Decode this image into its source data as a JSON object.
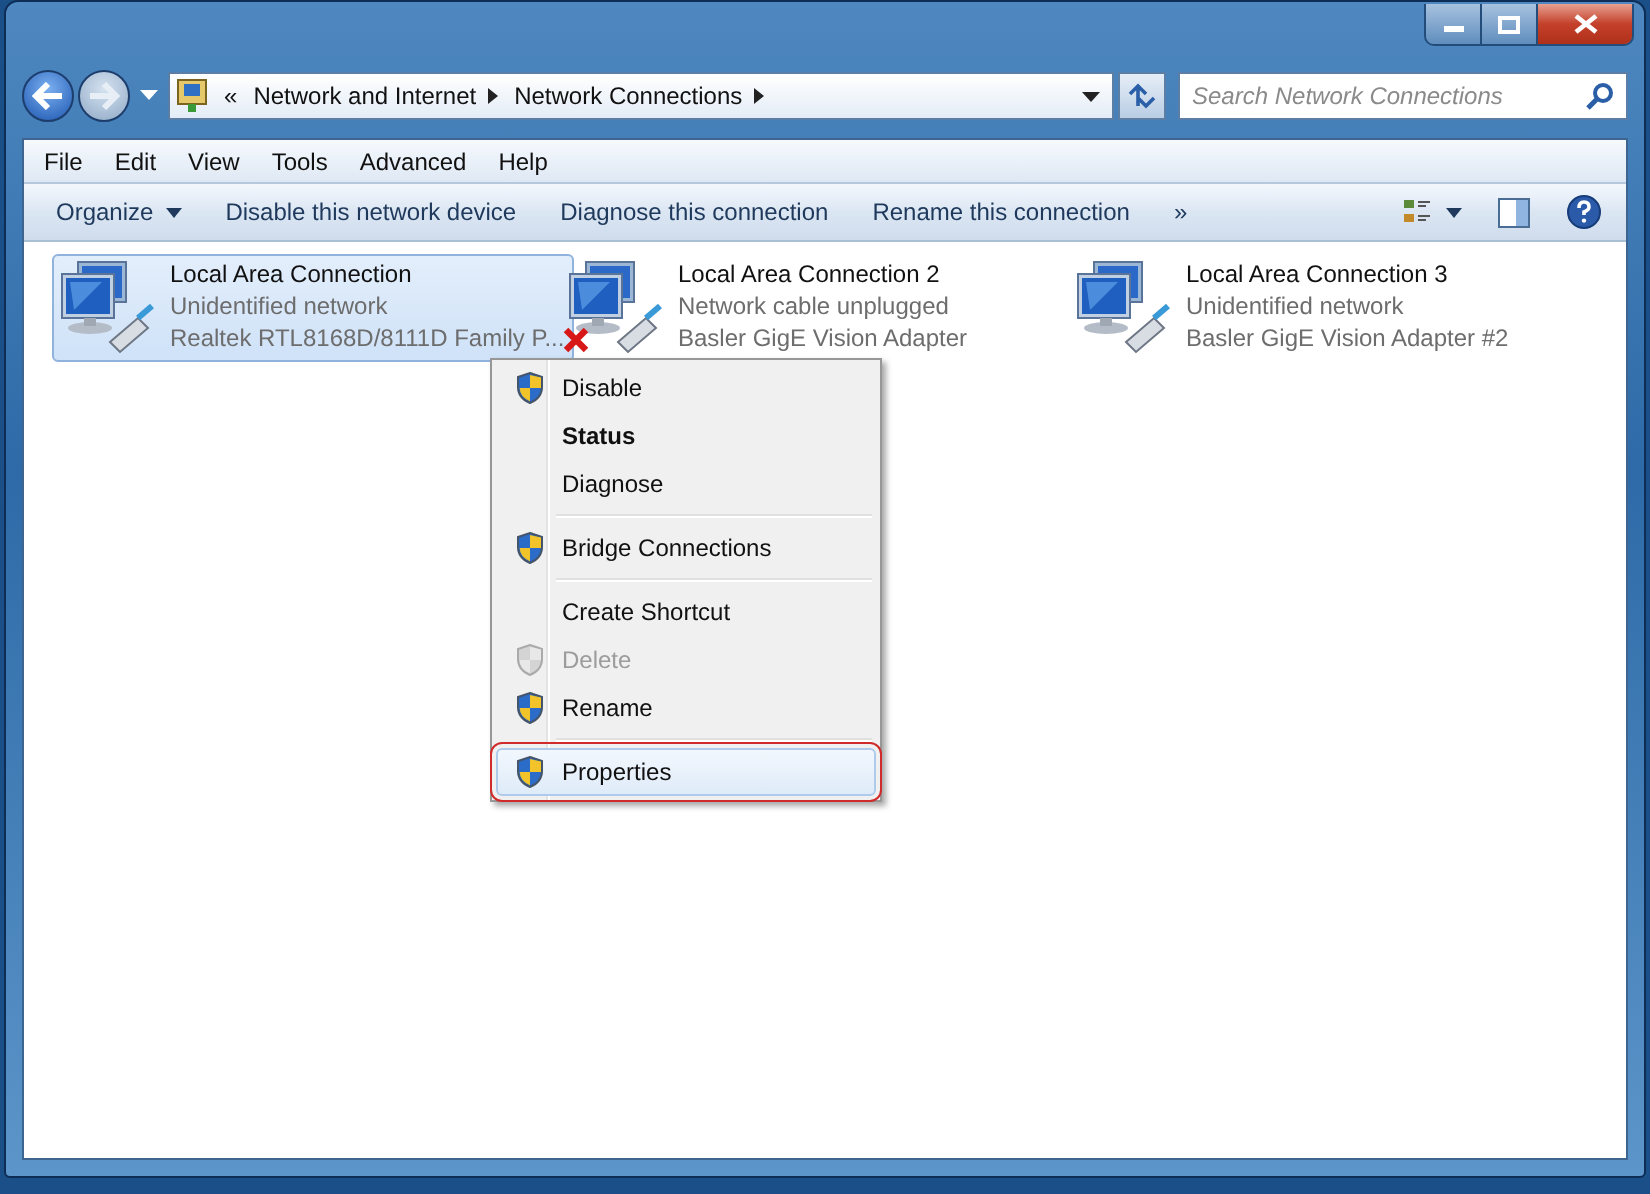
{
  "address": {
    "overflow": "«",
    "segments": [
      "Network and Internet",
      "Network Connections"
    ]
  },
  "search": {
    "placeholder": "Search Network Connections"
  },
  "menu": [
    "File",
    "Edit",
    "View",
    "Tools",
    "Advanced",
    "Help"
  ],
  "toolbar": {
    "buttons": [
      {
        "label": "Organize",
        "kind": "dropdown"
      },
      {
        "label": "Disable this network device",
        "kind": "plain"
      },
      {
        "label": "Diagnose this connection",
        "kind": "plain"
      },
      {
        "label": "Rename this connection",
        "kind": "plain"
      }
    ],
    "overflow": "»"
  },
  "connections": [
    {
      "name": "Local Area Connection",
      "status": "Unidentified network",
      "adapter": "Realtek RTL8168D/8111D Family P...",
      "selected": true,
      "unplugged": false
    },
    {
      "name": "Local Area Connection 2",
      "status": "Network cable unplugged",
      "adapter": "Basler GigE Vision Adapter",
      "selected": false,
      "unplugged": true
    },
    {
      "name": "Local Area Connection 3",
      "status": "Unidentified network",
      "adapter": "Basler GigE Vision Adapter #2",
      "selected": false,
      "unplugged": false
    }
  ],
  "context_menu": {
    "items": [
      {
        "kind": "item",
        "label": "Disable",
        "shield": true,
        "bold": false,
        "disabled": false,
        "selected": false
      },
      {
        "kind": "item",
        "label": "Status",
        "shield": false,
        "bold": true,
        "disabled": false,
        "selected": false
      },
      {
        "kind": "item",
        "label": "Diagnose",
        "shield": false,
        "bold": false,
        "disabled": false,
        "selected": false
      },
      {
        "kind": "separator"
      },
      {
        "kind": "item",
        "label": "Bridge Connections",
        "shield": true,
        "bold": false,
        "disabled": false,
        "selected": false
      },
      {
        "kind": "separator"
      },
      {
        "kind": "item",
        "label": "Create Shortcut",
        "shield": false,
        "bold": false,
        "disabled": false,
        "selected": false
      },
      {
        "kind": "item",
        "label": "Delete",
        "shield": true,
        "bold": false,
        "disabled": true,
        "selected": false
      },
      {
        "kind": "item",
        "label": "Rename",
        "shield": true,
        "bold": false,
        "disabled": false,
        "selected": false
      },
      {
        "kind": "separator"
      },
      {
        "kind": "item",
        "label": "Properties",
        "shield": true,
        "bold": false,
        "disabled": false,
        "selected": true
      }
    ]
  }
}
